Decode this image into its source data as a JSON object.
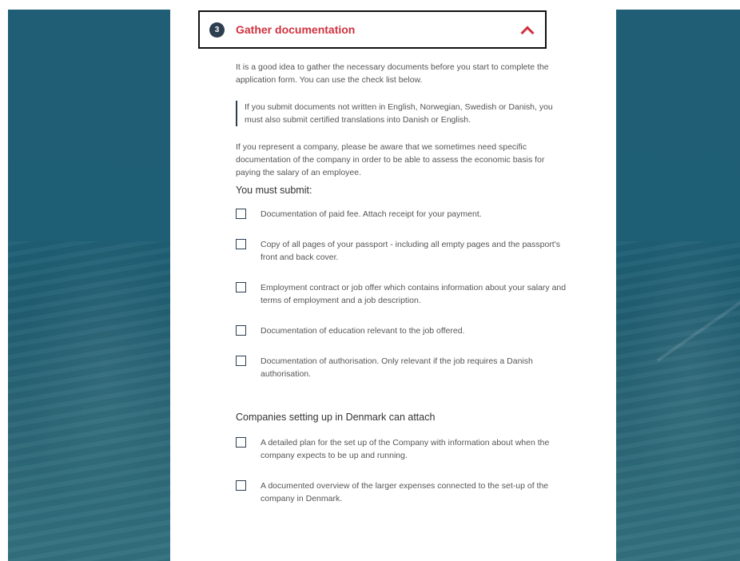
{
  "step": {
    "number": "3",
    "title": "Gather documentation",
    "expanded_icon": "chevron-up-icon"
  },
  "intro": "It is a good idea to gather the necessary documents before you start to complete the application form. You can use the check list below.",
  "note": "If you submit documents not written in English, Norwegian, Swedish or Danish, you must also submit certified translations into Danish or English.",
  "company_info": "If you represent a company, please be aware that we sometimes need specific documentation of the company in order to be able to assess the economic basis for paying the salary of an employee.",
  "must_submit": {
    "heading": "You must submit:",
    "items": [
      "Documentation of paid fee. Attach receipt for your payment.",
      "Copy of all pages of your passport - including all empty pages and the passport's front and back cover.",
      "Employment contract or job offer which contains information about your salary and terms of employment and a job description.",
      "Documentation of education relevant to the job offered.",
      "Documentation of authorisation. Only relevant if the job requires a Danish authorisation."
    ]
  },
  "companies": {
    "heading": "Companies setting up in Denmark can attach",
    "items": [
      "A detailed plan for the set up of the Company with information about when the company expects to be up and running.",
      "A documented overview of the larger expenses connected to the set-up of the company in Denmark."
    ]
  },
  "colors": {
    "accent": "#d0323f",
    "navy": "#2c3e50",
    "background_teal": "#1f5e74"
  }
}
